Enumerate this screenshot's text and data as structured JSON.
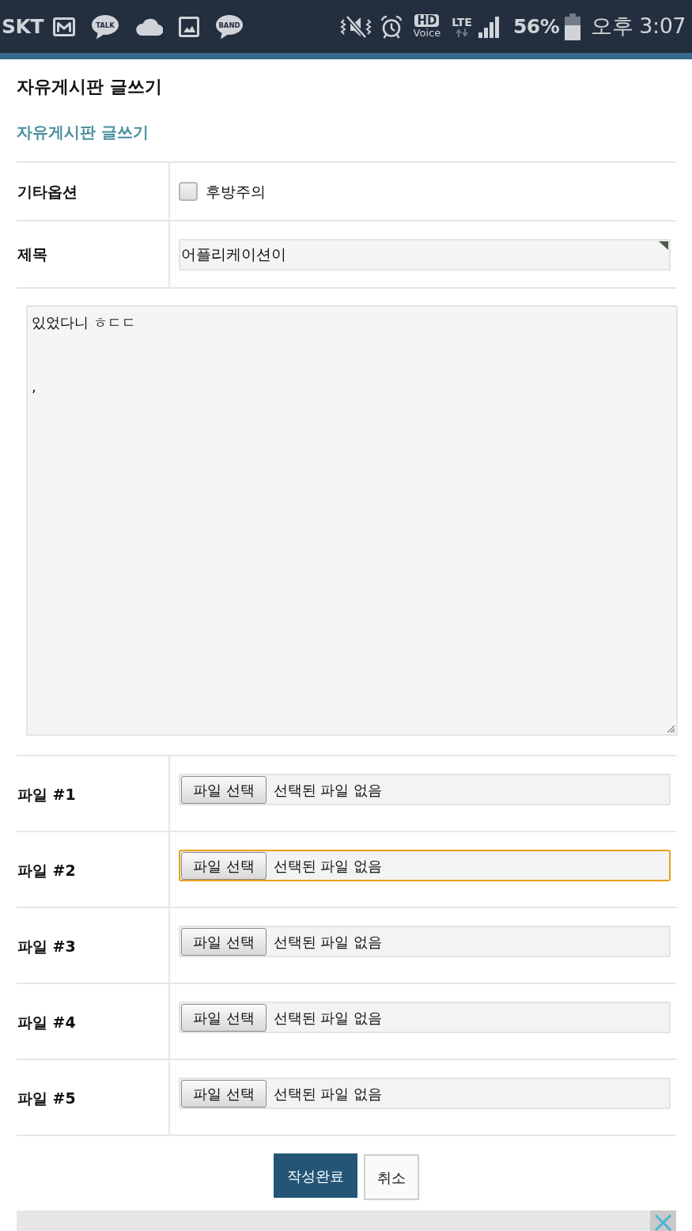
{
  "status_bar": {
    "carrier": "SKT",
    "talk_label": "TALK",
    "band_label": "BAND",
    "hd_label": "HD",
    "voice_label": "Voice",
    "network": "LTE",
    "battery": "56%",
    "time": "오후 3:07"
  },
  "page": {
    "title": "자유게시판 글쓰기",
    "breadcrumb": "자유게시판 글쓰기"
  },
  "form": {
    "options": {
      "label": "기타옵션",
      "checkbox_label": "후방주의",
      "checked": false
    },
    "subject": {
      "label": "제목",
      "value": "어플리케이션이"
    },
    "body": {
      "value": "있었다니 ㅎㄷㄷ\n\n\n,"
    },
    "files": [
      {
        "label": "파일 #1",
        "button": "파일 선택",
        "status": "선택된 파일 없음",
        "focused": false
      },
      {
        "label": "파일 #2",
        "button": "파일 선택",
        "status": "선택된 파일 없음",
        "focused": true
      },
      {
        "label": "파일 #3",
        "button": "파일 선택",
        "status": "선택된 파일 없음",
        "focused": false
      },
      {
        "label": "파일 #4",
        "button": "파일 선택",
        "status": "선택된 파일 없음",
        "focused": false
      },
      {
        "label": "파일 #5",
        "button": "파일 선택",
        "status": "선택된 파일 없음",
        "focused": false
      }
    ]
  },
  "buttons": [
    {
      "label": "작성완료",
      "kind": "primary"
    },
    {
      "label": "취소",
      "kind": "secondary"
    }
  ]
}
